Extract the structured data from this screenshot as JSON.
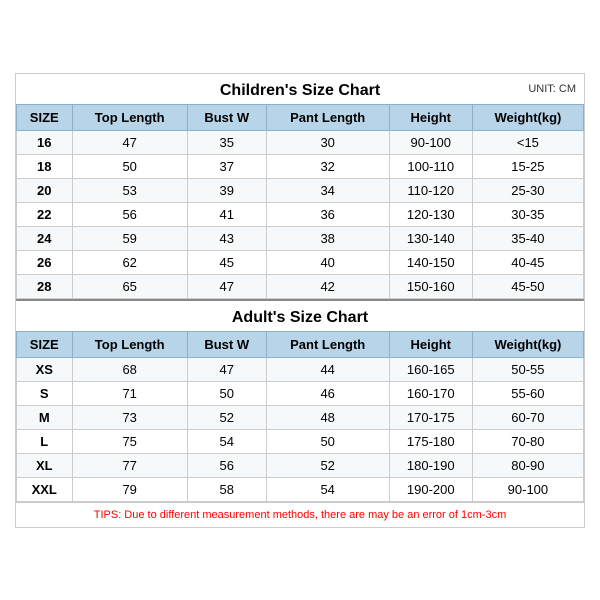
{
  "children_title": "Children's Size Chart",
  "unit": "UNIT: CM",
  "adult_title": "Adult's Size Chart",
  "tips": "TIPS: Due to different measurement methods, there are may be an error of 1cm-3cm",
  "columns": [
    "SIZE",
    "Top Length",
    "Bust W",
    "Pant Length",
    "Height",
    "Weight(kg)"
  ],
  "children_rows": [
    [
      "16",
      "47",
      "35",
      "30",
      "90-100",
      "<15"
    ],
    [
      "18",
      "50",
      "37",
      "32",
      "100-110",
      "15-25"
    ],
    [
      "20",
      "53",
      "39",
      "34",
      "110-120",
      "25-30"
    ],
    [
      "22",
      "56",
      "41",
      "36",
      "120-130",
      "30-35"
    ],
    [
      "24",
      "59",
      "43",
      "38",
      "130-140",
      "35-40"
    ],
    [
      "26",
      "62",
      "45",
      "40",
      "140-150",
      "40-45"
    ],
    [
      "28",
      "65",
      "47",
      "42",
      "150-160",
      "45-50"
    ]
  ],
  "adult_rows": [
    [
      "XS",
      "68",
      "47",
      "44",
      "160-165",
      "50-55"
    ],
    [
      "S",
      "71",
      "50",
      "46",
      "160-170",
      "55-60"
    ],
    [
      "M",
      "73",
      "52",
      "48",
      "170-175",
      "60-70"
    ],
    [
      "L",
      "75",
      "54",
      "50",
      "175-180",
      "70-80"
    ],
    [
      "XL",
      "77",
      "56",
      "52",
      "180-190",
      "80-90"
    ],
    [
      "XXL",
      "79",
      "58",
      "54",
      "190-200",
      "90-100"
    ]
  ]
}
